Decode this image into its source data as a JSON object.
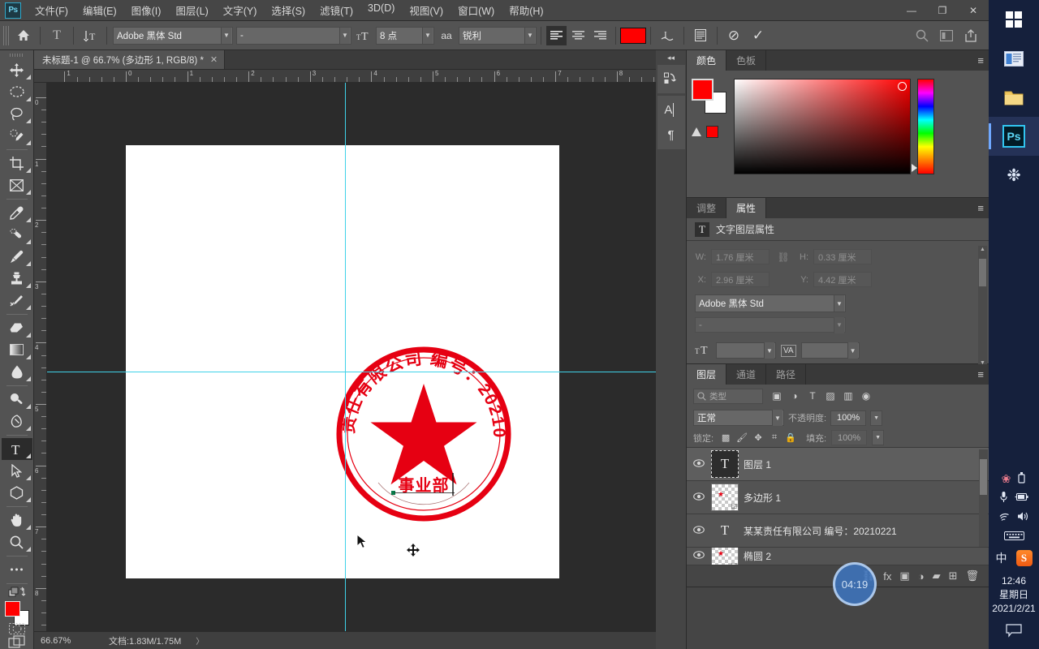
{
  "app": {
    "name": "Adobe Photoshop",
    "logo_text": "Ps"
  },
  "menubar": {
    "items": [
      {
        "label": "文件(F)"
      },
      {
        "label": "编辑(E)"
      },
      {
        "label": "图像(I)"
      },
      {
        "label": "图层(L)"
      },
      {
        "label": "文字(Y)"
      },
      {
        "label": "选择(S)"
      },
      {
        "label": "滤镜(T)"
      },
      {
        "label": "3D(D)"
      },
      {
        "label": "视图(V)"
      },
      {
        "label": "窗口(W)"
      },
      {
        "label": "帮助(H)"
      }
    ],
    "window_controls": {
      "minimize": "—",
      "restore": "❐",
      "close": "✕"
    }
  },
  "options_bar": {
    "home_icon": "home-icon",
    "tool_icon": "T",
    "orientation_icon": "↧T",
    "font_family": "Adobe 黑体 Std",
    "font_style": "-",
    "size_icon": "ᴛT",
    "font_size": "8 点",
    "aa_icon": "aa",
    "anti_alias": "锐利",
    "align_left": "align-left",
    "align_center": "align-center",
    "align_right": "align-right",
    "color_swatch": "#ff0000",
    "warp_icon": "warp-text",
    "panel_icon": "character-panel",
    "cancel_icon": "⊘",
    "commit_icon": "✓",
    "search_icon": "search",
    "arrange_icon": "arrange",
    "share_icon": "share"
  },
  "document_tab": {
    "title": "未标题-1 @ 66.7% (多边形 1, RGB/8) *",
    "close": "✕"
  },
  "toolbar": {
    "tools": [
      {
        "name": "move-tool",
        "glyph": "✥",
        "active": false
      },
      {
        "name": "marquee-tool",
        "glyph": "◌",
        "active": false
      },
      {
        "name": "lasso-tool",
        "glyph": "◯",
        "active": false
      },
      {
        "name": "quick-selection-tool",
        "glyph": "❏",
        "active": false
      },
      {
        "name": "crop-tool",
        "glyph": "⌗",
        "active": false
      },
      {
        "name": "frame-tool",
        "glyph": "⊠",
        "active": false
      },
      {
        "name": "eyedropper-tool",
        "glyph": "✎",
        "active": false
      },
      {
        "name": "healing-brush-tool",
        "glyph": "✚",
        "active": false
      },
      {
        "name": "brush-tool",
        "glyph": "🖌",
        "active": false
      },
      {
        "name": "clone-stamp-tool",
        "glyph": "⚲",
        "active": false
      },
      {
        "name": "history-brush-tool",
        "glyph": "✧",
        "active": false
      },
      {
        "name": "eraser-tool",
        "glyph": "◺",
        "active": false
      },
      {
        "name": "gradient-tool",
        "glyph": "▤",
        "active": false
      },
      {
        "name": "blur-tool",
        "glyph": "💧",
        "active": false
      },
      {
        "name": "dodge-tool",
        "glyph": "⌕",
        "active": false
      },
      {
        "name": "pen-tool",
        "glyph": "✒",
        "active": false
      },
      {
        "name": "type-tool",
        "glyph": "T",
        "active": true
      },
      {
        "name": "path-selection-tool",
        "glyph": "➤",
        "active": false
      },
      {
        "name": "shape-tool",
        "glyph": "⬡",
        "active": false
      },
      {
        "name": "hand-tool",
        "glyph": "✋",
        "active": false
      },
      {
        "name": "zoom-tool",
        "glyph": "🔍",
        "active": false
      },
      {
        "name": "more-tools",
        "glyph": "•••",
        "active": false
      }
    ],
    "foreground_color": "#ff0000",
    "background_color": "#ffffff",
    "quick_mask": "quick-mask",
    "screen_mode": "screen-mode"
  },
  "rulers": {
    "horizontal_labels": [
      "1",
      "0",
      "1",
      "2",
      "3",
      "4",
      "5",
      "6",
      "7"
    ],
    "vertical_labels": [
      "0",
      "1",
      "2",
      "3",
      "4",
      "5",
      "6"
    ]
  },
  "canvas": {
    "stamp": {
      "top_text": "某某责任有限公司 编号：20210221",
      "bottom_text": "事业部",
      "ring_color": "#e60012",
      "star_color": "#e60012"
    },
    "guides_color": "#3fd2e8"
  },
  "statusbar": {
    "zoom": "66.67%",
    "doc_label": "文档:1.83M/1.75M",
    "expand": "〉"
  },
  "rail": {
    "collapse": "◂◂",
    "icons": [
      {
        "name": "history-icon",
        "glyph": "⤿"
      },
      {
        "name": "character-icon",
        "glyph": "A"
      },
      {
        "name": "paragraph-icon",
        "glyph": "¶"
      }
    ]
  },
  "color_panel": {
    "tabs": [
      {
        "label": "颜色",
        "active": true
      },
      {
        "label": "色板",
        "active": false
      }
    ],
    "menu": "≡",
    "foreground": "#ff0000",
    "background": "#ffffff",
    "gamut_warning_swatch": "#ff0000"
  },
  "properties_panel": {
    "tabs": [
      {
        "label": "调整",
        "active": false
      },
      {
        "label": "属性",
        "active": true
      }
    ],
    "menu": "≡",
    "header_icon": "T",
    "header": "文字图层属性",
    "fields": {
      "w_label": "W:",
      "w_value": "1.76 厘米",
      "link_icon": "⛓",
      "h_label": "H:",
      "h_value": "0.33 厘米",
      "x_label": "X:",
      "x_value": "2.96 厘米",
      "y_label": "Y:",
      "y_value": "4.42 厘米"
    },
    "font_family": "Adobe 黑体 Std",
    "font_style": "-",
    "size_icon": "ᴛT",
    "size_value": "",
    "tracking_icon": "VA",
    "tracking_value": ""
  },
  "layers_panel": {
    "tabs": [
      {
        "label": "图层",
        "active": true
      },
      {
        "label": "通道",
        "active": false
      },
      {
        "label": "路径",
        "active": false
      }
    ],
    "menu": "≡",
    "filter_placeholder": "类型",
    "filter_icons": [
      {
        "name": "filter-pixel-icon",
        "glyph": "▣"
      },
      {
        "name": "filter-adjustment-icon",
        "glyph": "◑"
      },
      {
        "name": "filter-type-icon",
        "glyph": "T"
      },
      {
        "name": "filter-shape-icon",
        "glyph": "▨"
      },
      {
        "name": "filter-smart-icon",
        "glyph": "▥"
      },
      {
        "name": "filter-toggle-icon",
        "glyph": "◉"
      }
    ],
    "blend_mode": "正常",
    "opacity_label": "不透明度:",
    "opacity_value": "100%",
    "lock_label": "锁定:",
    "lock_icons": [
      {
        "name": "lock-transparent-icon",
        "glyph": "▩"
      },
      {
        "name": "lock-image-icon",
        "glyph": "🖌"
      },
      {
        "name": "lock-position-icon",
        "glyph": "✥"
      },
      {
        "name": "lock-artboard-icon",
        "glyph": "⌗"
      },
      {
        "name": "lock-all-icon",
        "glyph": "🔒"
      }
    ],
    "fill_label": "填充:",
    "fill_value": "100%",
    "layers": [
      {
        "name": "图层 1",
        "type": "text",
        "selected": true,
        "visible": true
      },
      {
        "name": "多边形 1",
        "type": "shape",
        "selected": false,
        "visible": true
      },
      {
        "name": "某某责任有限公司 编号：20210221",
        "type": "text",
        "selected": false,
        "visible": true
      },
      {
        "name": "椭圆 2",
        "type": "shape",
        "selected": false,
        "visible": true
      }
    ],
    "bottom_icons": [
      {
        "name": "link-layers-icon",
        "glyph": "⛓"
      },
      {
        "name": "layer-style-icon",
        "glyph": "fx"
      },
      {
        "name": "layer-mask-icon",
        "glyph": "▣"
      },
      {
        "name": "adjustment-layer-icon",
        "glyph": "◑"
      },
      {
        "name": "new-group-icon",
        "glyph": "▰"
      },
      {
        "name": "new-layer-icon",
        "glyph": "⊞"
      },
      {
        "name": "delete-layer-icon",
        "glyph": "🗑"
      }
    ]
  },
  "timer_overlay": {
    "text": "04:19"
  },
  "taskbar": {
    "items": [
      {
        "name": "start-button",
        "glyph": "win",
        "active": false
      },
      {
        "name": "task-view-button",
        "glyph": "▤",
        "active": false
      },
      {
        "name": "file-explorer-button",
        "glyph": "📁",
        "active": false
      },
      {
        "name": "photoshop-taskbar-button",
        "glyph": "Ps",
        "active": true
      },
      {
        "name": "app-taskbar-button",
        "glyph": "❉",
        "active": false
      }
    ],
    "tray": [
      {
        "name": "flower-tray-icon",
        "glyph": "❀"
      },
      {
        "name": "usb-tray-icon",
        "glyph": "⛁"
      },
      {
        "name": "microphone-tray-icon",
        "glyph": "🎙"
      },
      {
        "name": "battery-tray-icon",
        "glyph": "🔋"
      },
      {
        "name": "wifi-tray-icon",
        "glyph": "📶"
      },
      {
        "name": "volume-tray-icon",
        "glyph": "🔊"
      },
      {
        "name": "keyboard-tray-icon",
        "glyph": "⌨"
      },
      {
        "name": "ime-tray-icon",
        "glyph": "中"
      },
      {
        "name": "sogou-tray-icon",
        "glyph": "S"
      }
    ],
    "clock": {
      "time": "12:46",
      "weekday": "星期日",
      "date": "2021/2/21"
    },
    "notification": "🗨"
  }
}
